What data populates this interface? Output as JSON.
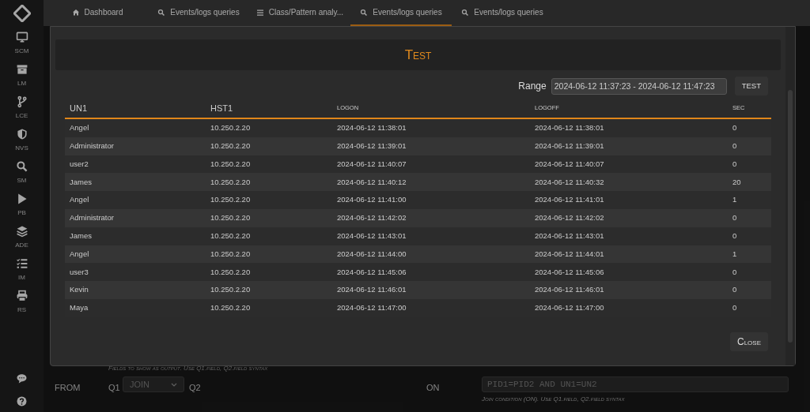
{
  "sidebar": {
    "items": [
      {
        "kind": "monitor",
        "label": "SCM"
      },
      {
        "kind": "archive",
        "label": "LM"
      },
      {
        "kind": "branch",
        "label": "LCE"
      },
      {
        "kind": "shield",
        "label": "NVS"
      },
      {
        "kind": "search",
        "label": "SM"
      },
      {
        "kind": "play",
        "label": "PB"
      },
      {
        "kind": "layers",
        "label": "ADE"
      },
      {
        "kind": "checklist",
        "label": "IM"
      },
      {
        "kind": "printer",
        "label": "RS"
      }
    ],
    "bottom_icons": [
      {
        "kind": "chat"
      },
      {
        "kind": "help"
      }
    ]
  },
  "tabs": [
    {
      "kind": "home",
      "label": "Dashboard",
      "selected": false
    },
    {
      "kind": "search",
      "label": "Events/logs queries",
      "selected": false
    },
    {
      "kind": "list",
      "label": "Class/Pattern analy...",
      "selected": false
    },
    {
      "kind": "search",
      "label": "Events/logs queries",
      "selected": true
    },
    {
      "kind": "search",
      "label": "Events/logs queries",
      "selected": false
    }
  ],
  "background_form": {
    "fields_hint": "Fields to show as output. Use Q1.field, Q2.field syntax",
    "from_label": "FROM",
    "q1_label": "Q1",
    "join_select": "JOIN",
    "q2_label": "Q2",
    "on_label": "ON",
    "on_value": "PID1=PID2 AND UN1=UN2",
    "on_hint": "Join condition (ON). Use Q1.field, Q2.field syntax"
  },
  "dialog": {
    "title": "Test",
    "range_label": "Range",
    "range_value": "2024-06-12 11:37:23 - 2024-06-12 11:47:23",
    "test_button": "TEST",
    "table": {
      "columns": [
        {
          "kind": "large",
          "label": "UN1"
        },
        {
          "kind": "large",
          "label": "HST1"
        },
        {
          "kind": "small",
          "label": "LOGON"
        },
        {
          "kind": "small",
          "label": "LOGOFF"
        },
        {
          "kind": "small",
          "label": "SEC"
        }
      ],
      "rows": [
        [
          "Angel",
          "10.250.2.20",
          "2024-06-12 11:38:01",
          "2024-06-12 11:38:01",
          "0"
        ],
        [
          "Administrator",
          "10.250.2.20",
          "2024-06-12 11:39:01",
          "2024-06-12 11:39:01",
          "0"
        ],
        [
          "user2",
          "10.250.2.20",
          "2024-06-12 11:40:07",
          "2024-06-12 11:40:07",
          "0"
        ],
        [
          "James",
          "10.250.2.20",
          "2024-06-12 11:40:12",
          "2024-06-12 11:40:32",
          "20"
        ],
        [
          "Angel",
          "10.250.2.20",
          "2024-06-12 11:41:00",
          "2024-06-12 11:41:01",
          "1"
        ],
        [
          "Administrator",
          "10.250.2.20",
          "2024-06-12 11:42:02",
          "2024-06-12 11:42:02",
          "0"
        ],
        [
          "James",
          "10.250.2.20",
          "2024-06-12 11:43:01",
          "2024-06-12 11:43:01",
          "0"
        ],
        [
          "Angel",
          "10.250.2.20",
          "2024-06-12 11:44:00",
          "2024-06-12 11:44:01",
          "1"
        ],
        [
          "user3",
          "10.250.2.20",
          "2024-06-12 11:45:06",
          "2024-06-12 11:45:06",
          "0"
        ],
        [
          "Kevin",
          "10.250.2.20",
          "2024-06-12 11:46:01",
          "2024-06-12 11:46:01",
          "0"
        ],
        [
          "Maya",
          "10.250.2.20",
          "2024-06-12 11:47:00",
          "2024-06-12 11:47:00",
          "0"
        ]
      ]
    },
    "close_button": "Close"
  }
}
